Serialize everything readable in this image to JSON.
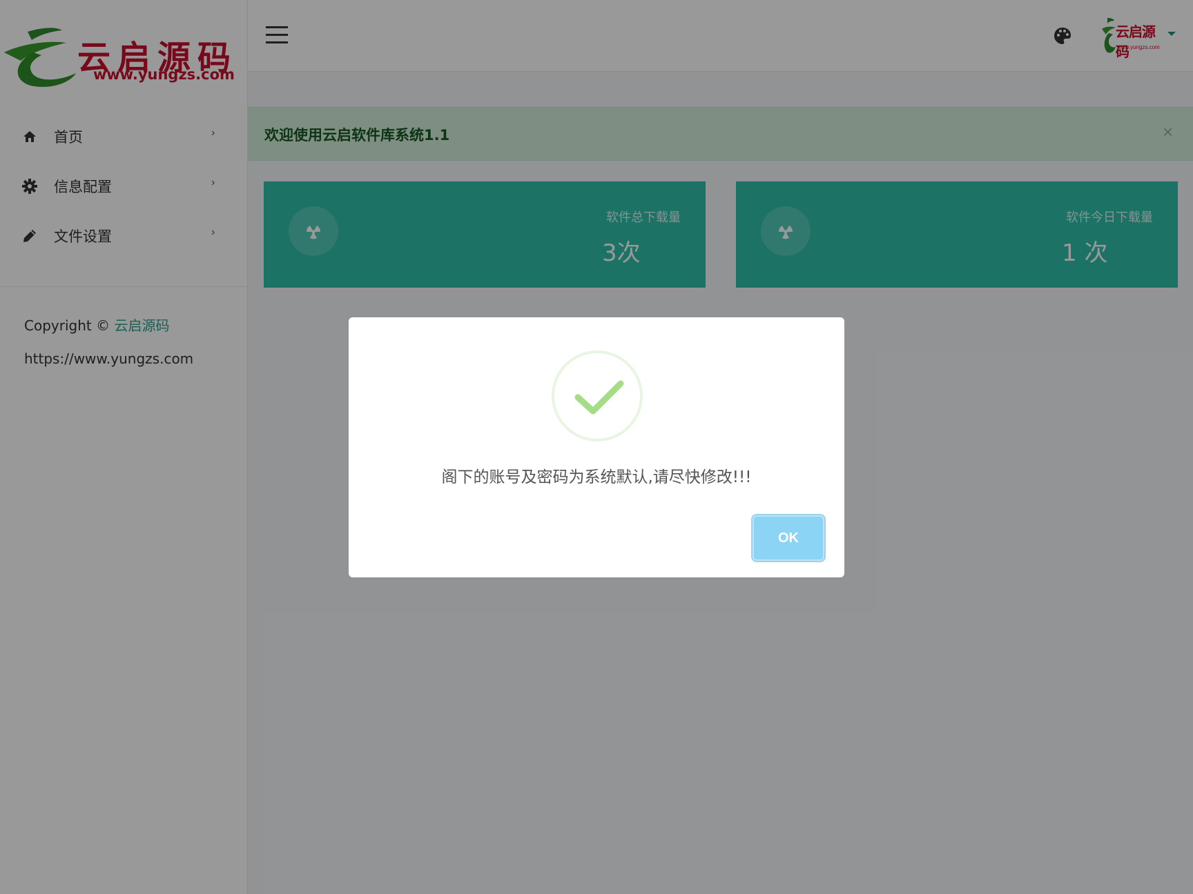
{
  "sidebar": {
    "logo": {
      "text": "云启源码",
      "url": "www.yungzs.com"
    },
    "items": [
      {
        "label": "首页",
        "icon": "home-icon"
      },
      {
        "label": "信息配置",
        "icon": "gear-icon"
      },
      {
        "label": "文件设置",
        "icon": "pencil-icon"
      }
    ],
    "copyright_prefix": "Copyright © ",
    "copyright_link": "云启源码",
    "site_url": "https://www.yungzs.com"
  },
  "header": {
    "avatar_text": "云启源码",
    "avatar_url": "www.yungzs.com"
  },
  "alert": {
    "text": "欢迎使用云启软件库系统1.1",
    "close": "×"
  },
  "cards": [
    {
      "title": "软件总下载量",
      "value": "3次",
      "icon": "radiation-icon"
    },
    {
      "title": "软件今日下载量",
      "value": "1 次",
      "icon": "radiation-icon"
    }
  ],
  "modal": {
    "message": "阁下的账号及密码为系统默认,请尽快修改!!!",
    "ok_label": "OK",
    "icon": "success-check-icon"
  },
  "colors": {
    "brand_red": "#c8102e",
    "teal": "#2dbfa8",
    "accent_link": "#2e9f8e",
    "alert_bg": "#d4edda",
    "ok_button": "#8cd4f5",
    "check_green": "#a5dc86"
  }
}
